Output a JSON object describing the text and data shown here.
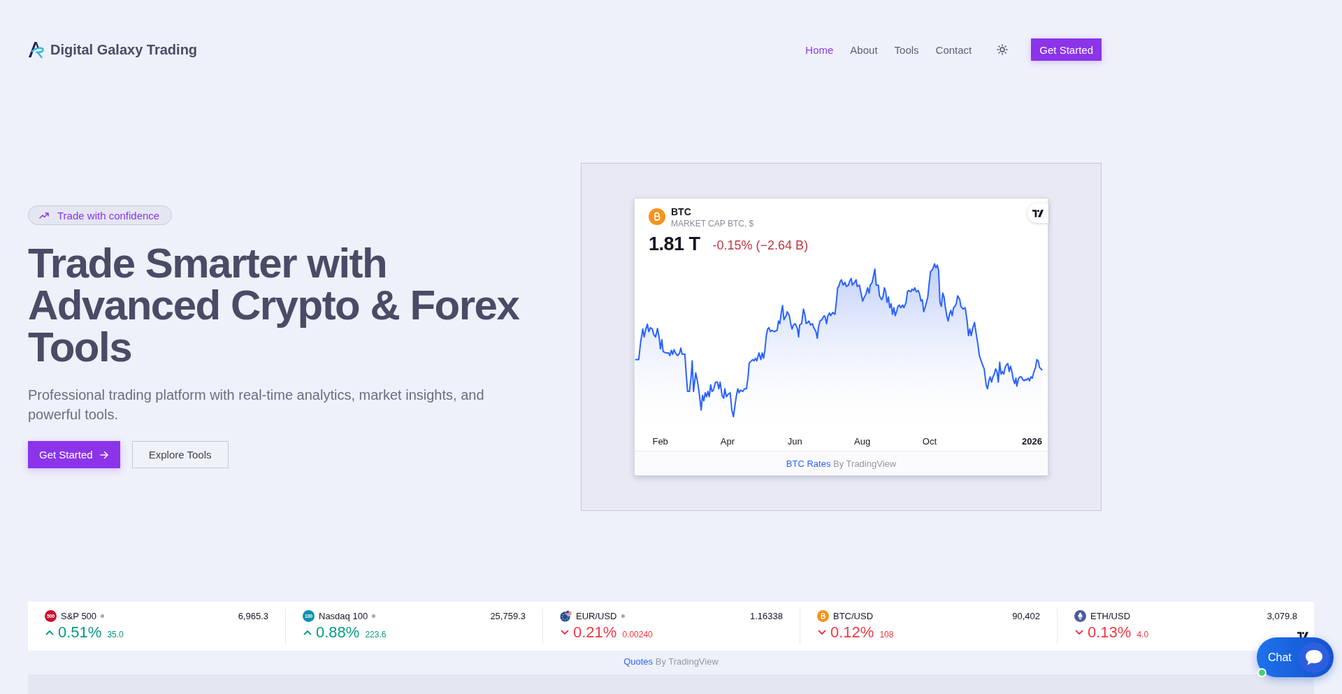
{
  "header": {
    "brand": "Digital Galaxy Trading",
    "nav": [
      {
        "label": "Home",
        "selected": true
      },
      {
        "label": "About",
        "selected": false
      },
      {
        "label": "Tools",
        "selected": false
      },
      {
        "label": "Contact",
        "selected": false
      }
    ],
    "cta": "Get Started"
  },
  "hero": {
    "badge": "Trade with confidence",
    "title": "Trade Smarter with Advanced Crypto & Forex Tools",
    "subtitle": "Professional trading platform with real-time analytics, market insights, and powerful tools.",
    "buttons": [
      {
        "label": "Get Started",
        "kind": "primary"
      },
      {
        "label": "Explore Tools",
        "kind": "secondary"
      }
    ]
  },
  "btc_widget": {
    "symbol": "BTC",
    "subtitle": "MARKET CAP BTC, $",
    "value": "1.81 T",
    "change": "-0.15% (−2.64 B)",
    "rising": false,
    "axis_labels": [
      {
        "label": "Feb",
        "kind": "month"
      },
      {
        "label": "Apr",
        "kind": "month"
      },
      {
        "label": "Jun",
        "kind": "month"
      },
      {
        "label": "Aug",
        "kind": "month"
      },
      {
        "label": "Oct",
        "kind": "month"
      },
      {
        "label": "2026",
        "kind": "year"
      }
    ],
    "footer_link": "BTC Rates",
    "footer_text": "By TradingView"
  },
  "ticker": {
    "items": [
      {
        "kind": "index",
        "logo_text": "500",
        "color": "#c8102e",
        "name": "S&P 500",
        "status_dot": true,
        "price": "6,965.3",
        "rising": true,
        "change_percent": "0.51%",
        "change": "35.0"
      },
      {
        "kind": "index",
        "logo_text": "100",
        "color": "#0a8fb0",
        "name": "Nasdaq 100",
        "status_dot": true,
        "price": "25,759.3",
        "rising": true,
        "change_percent": "0.88%",
        "change": "223.6"
      },
      {
        "kind": "forex",
        "name": "EUR/USD",
        "status_dot": true,
        "price": "1.16338",
        "rising": false,
        "change_percent": "0.21%",
        "change": "0.00240"
      },
      {
        "kind": "btc",
        "name": "BTC/USD",
        "status_dot": false,
        "price": "90,402",
        "rising": false,
        "change_percent": "0.12%",
        "change": "108"
      },
      {
        "kind": "eth",
        "name": "ETH/USD",
        "status_dot": false,
        "price": "3,079.8",
        "rising": false,
        "change_percent": "0.13%",
        "change": "4.0"
      }
    ],
    "footer_link": "Quotes",
    "footer_text": "By TradingView"
  },
  "chat": {
    "label": "Chat",
    "online": true
  }
}
